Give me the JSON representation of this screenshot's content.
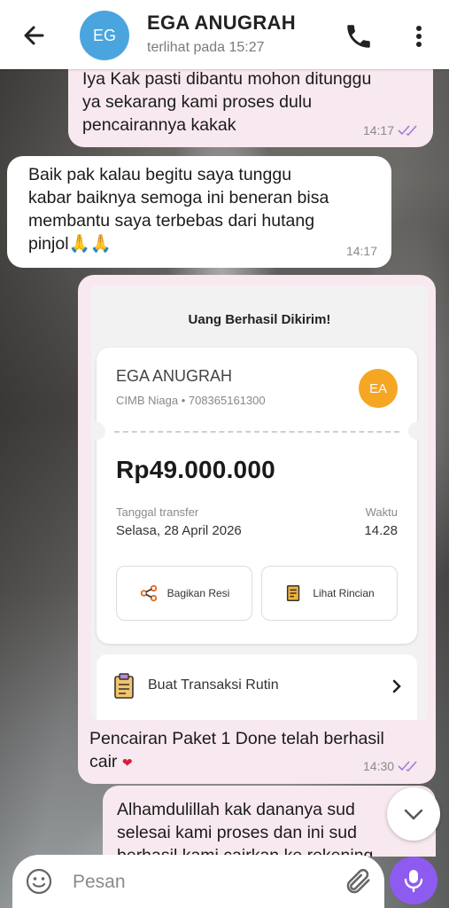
{
  "header": {
    "avatar_initials": "EG",
    "contact_name": "EGA ANUGRAH",
    "status": "terlihat pada  15:27"
  },
  "messages": [
    {
      "direction": "out",
      "text": "Iya Kak pasti dibantu mohon ditunggu\nya sekarang kami proses dulu\npencairannya kakak",
      "time": "14:17",
      "read": true
    },
    {
      "direction": "in",
      "text": "Baik pak kalau begitu saya tunggu\nkabar baiknya semoga ini beneran bisa\nmembantu saya terbebas dari hutang\npinjol🙏🙏",
      "time": "14:17"
    },
    {
      "direction": "out",
      "caption": "Pencairan Paket 1 Done telah berhasil\ncair",
      "time": "14:30",
      "read": true
    },
    {
      "direction": "out",
      "text": "Alhamdulillah kak dananya sud\nselesai kami proses dan ini sud\nberhasil kami cairkan ke rekening",
      "partial": true
    }
  ],
  "receipt": {
    "title": "Uang Berhasil Dikirim!",
    "recipient_name": "EGA ANUGRAH",
    "recipient_bank": "CIMB Niaga • 708365161300",
    "recipient_initials": "EA",
    "amount": "Rp49.000.000",
    "date_label": "Tanggal transfer",
    "date": "Selasa, 28 April 2026",
    "time_label": "Waktu",
    "time": "14.28",
    "share_label": "Bagikan Resi",
    "details_label": "Lihat Rincian",
    "recurring_label": "Buat Transaksi Rutin"
  },
  "composer": {
    "placeholder": "Pesan"
  },
  "colors": {
    "outgoing_bubble": "#f8e8ef",
    "incoming_bubble": "#ffffff",
    "accent": "#8e5bf0",
    "avatar": "#4aa5de",
    "read_ticks": "#9b7fd6"
  }
}
